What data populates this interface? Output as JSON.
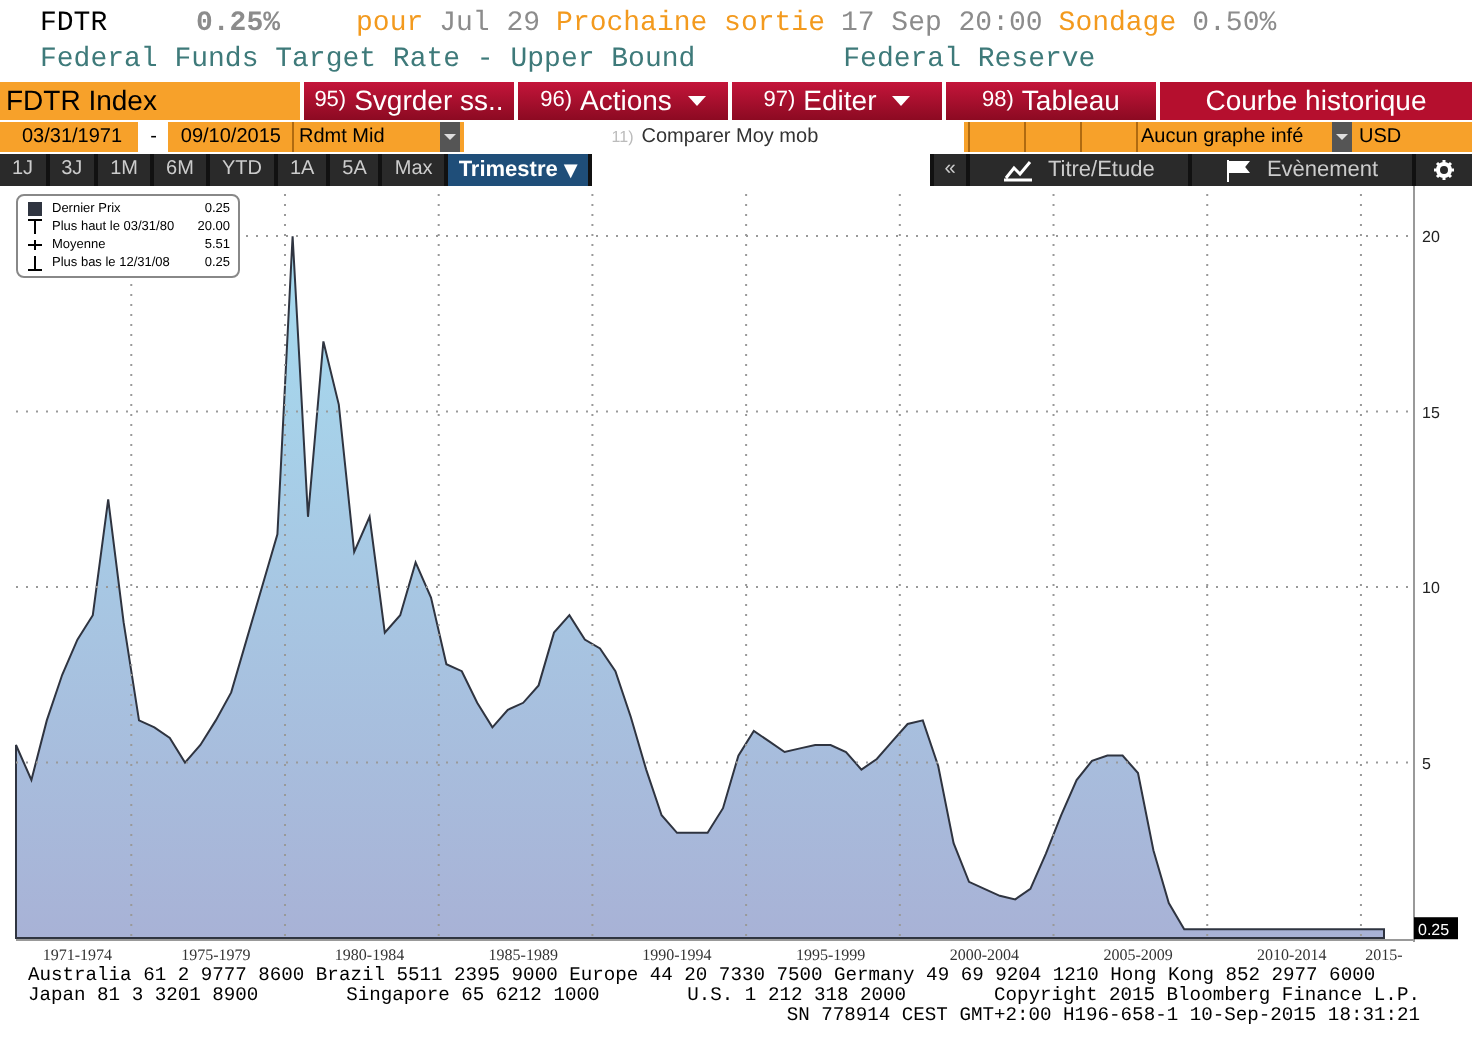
{
  "header": {
    "ticker": "FDTR",
    "value": "0.25%",
    "segments": [
      {
        "kind": "label",
        "text": "pour"
      },
      {
        "kind": "value",
        "text": "Jul 29"
      },
      {
        "kind": "label",
        "text": "Prochaine sortie"
      },
      {
        "kind": "value",
        "text": "17 Sep 20:00"
      },
      {
        "kind": "label",
        "text": "Sondage"
      },
      {
        "kind": "value",
        "text": "0.50%"
      }
    ],
    "description": "Federal Funds Target Rate - Upper Bound",
    "source": "Federal Reserve"
  },
  "menu_bar": {
    "security": "FDTR Index",
    "buttons": [
      {
        "number": "95)",
        "label": "Svgrder ss..",
        "dropdown": false
      },
      {
        "number": "96)",
        "label": "Actions",
        "dropdown": true
      },
      {
        "number": "97)",
        "label": "Editer",
        "dropdown": true
      },
      {
        "number": "98)",
        "label": "Tableau",
        "dropdown": false
      }
    ],
    "title": "Courbe historique"
  },
  "controls": {
    "start_date": "03/31/1971",
    "separator": "-",
    "end_date": "09/10/2015",
    "yield": "Rdmt Mid",
    "compare": {
      "number": "11)",
      "label": "Comparer Moy mob"
    },
    "lower_chart": "Aucun graphe infé",
    "currency": "USD"
  },
  "toolbar": {
    "periods": [
      {
        "label": "1J",
        "selected": false
      },
      {
        "label": "3J",
        "selected": false
      },
      {
        "label": "1M",
        "selected": false
      },
      {
        "label": "6M",
        "selected": false
      },
      {
        "label": "YTD",
        "selected": false
      },
      {
        "label": "1A",
        "selected": false
      },
      {
        "label": "5A",
        "selected": false
      },
      {
        "label": "Max",
        "selected": false
      }
    ],
    "frequency": {
      "label": "Trimestre",
      "arrow": "▼"
    },
    "collapse": "«",
    "buttons": [
      {
        "kind": "chart",
        "label": "Titre/Etude"
      },
      {
        "kind": "flag",
        "label": "Evènement"
      }
    ]
  },
  "legend": [
    {
      "kind": "last",
      "value": "0.25"
    },
    {
      "kind": "high",
      "label": "Plus haut le 03/31/80",
      "value": "20.00"
    },
    {
      "kind": "average",
      "label": "Moyenne",
      "value": "5.51"
    },
    {
      "kind": "low",
      "label": "Plus bas le 12/31/08",
      "value": "0.25"
    }
  ],
  "chart": {
    "chart_data": {
      "type": "area",
      "categories": [
        null,
        null,
        null,
        null,
        "1971-1974",
        null,
        null,
        null,
        null,
        null,
        null,
        null,
        null,
        "1975-1979",
        null,
        null,
        null,
        null,
        null,
        null,
        null,
        null,
        null,
        "1980-1984",
        null,
        null,
        null,
        null,
        null,
        null,
        null,
        null,
        null,
        "1985-1989",
        null,
        null,
        null,
        null,
        null,
        null,
        null,
        null,
        null,
        "1990-1994",
        null,
        null,
        null,
        null,
        null,
        null,
        null,
        null,
        null,
        "1995-1999",
        null,
        null,
        null,
        null,
        null,
        null,
        null,
        null,
        null,
        "2000-2004",
        null,
        null,
        null,
        null,
        null,
        null,
        null,
        null,
        null,
        "2005-2009",
        null,
        null,
        null,
        null,
        null,
        null,
        null,
        null,
        null,
        "2010-2014",
        null,
        null,
        null,
        null,
        null,
        "2015-"
      ],
      "series": [
        {
          "name": "Dernier Prix",
          "color": "#2f3440",
          "values": [
            5.5,
            4.5,
            6.2,
            7.5,
            8.5,
            9.2,
            12.5,
            9.0,
            6.2,
            6.0,
            5.7,
            5.0,
            5.5,
            6.2,
            7.0,
            8.5,
            10.0,
            11.5,
            20.0,
            12.0,
            17.0,
            15.2,
            11.0,
            12.0,
            8.7,
            9.2,
            10.7,
            9.7,
            7.8,
            7.6,
            6.7,
            6.0,
            6.5,
            6.7,
            7.2,
            8.7,
            9.2,
            8.5,
            8.25,
            7.6,
            6.3,
            4.8,
            3.5,
            3.0,
            3.0,
            3.0,
            3.7,
            5.2,
            5.9,
            5.6,
            5.3,
            5.4,
            5.5,
            5.5,
            5.3,
            4.8,
            5.1,
            5.6,
            6.1,
            6.2,
            4.9,
            2.7,
            1.6,
            1.4,
            1.2,
            1.1,
            1.4,
            2.4,
            3.5,
            4.5,
            5.05,
            5.2,
            5.2,
            4.7,
            2.5,
            1.0,
            0.25,
            0.25,
            0.25,
            0.25,
            0.25,
            0.25,
            0.25,
            0.25,
            0.25,
            0.25,
            0.25,
            0.25,
            0.25,
            0.25
          ]
        }
      ],
      "yticks": [
        5,
        10,
        15,
        20
      ],
      "ylim": [
        0,
        21.2
      ],
      "grid": true,
      "annotations": [
        "0.25"
      ]
    }
  },
  "footer": {
    "lines": [
      [
        "Australia 61 2 9777 8600 Brazil 5511 2395 9000 Europe 44 20 7330 7500 Germany 49 69 9204 1210 Hong Kong 852 2977 6000"
      ],
      [
        "Japan 81 3 3201 8900",
        "Singapore 65 6212 1000",
        "U.S. 1 212 318 2000",
        "Copyright 2015 Bloomberg Finance L.P."
      ],
      [
        "SN 778914 CEST GMT+2:00 H196-658-1 10-Sep-2015 18:31:21"
      ]
    ]
  }
}
